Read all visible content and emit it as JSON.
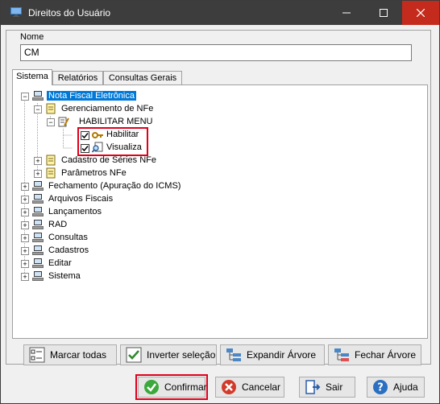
{
  "window": {
    "title": "Direitos do Usuário"
  },
  "nome": {
    "label": "Nome",
    "value": "CM"
  },
  "tabs": [
    {
      "label": "Sistema",
      "active": true
    },
    {
      "label": "Relatórios",
      "active": false
    },
    {
      "label": "Consultas Gerais",
      "active": false
    }
  ],
  "tree": {
    "nota_fiscal": "Nota Fiscal Eletrônica",
    "gerenciamento": "Gerenciamento de NFe",
    "habilitar_menu": "HABILITAR MENU",
    "habilitar": "Habilitar",
    "visualiza": "Visualiza",
    "cadastro_series": "Cadastro de Séries NFe",
    "parametros": "Parâmetros NFe",
    "fechamento": "Fechamento (Apuração do ICMS)",
    "arquivos_fiscais": "Arquivos Fiscais",
    "lancamentos": "Lançamentos",
    "rad": "RAD",
    "consultas": "Consultas",
    "cadastros": "Cadastros",
    "editar": "Editar",
    "sistema": "Sistema",
    "expand_minus": "−",
    "expand_plus": "+"
  },
  "tree_buttons": {
    "marcar": "Marcar todas",
    "inverter": "Inverter seleção",
    "expandir": "Expandir Árvore",
    "fechar": "Fechar Árvore"
  },
  "footer_buttons": {
    "confirmar": "Confirmar",
    "cancelar": "Cancelar",
    "sair": "Sair",
    "ajuda": "Ajuda"
  },
  "colors": {
    "selection": "#0078d7",
    "highlight": "#e0001b",
    "titlebar": "#3d3d3d",
    "close": "#c42b1c"
  }
}
